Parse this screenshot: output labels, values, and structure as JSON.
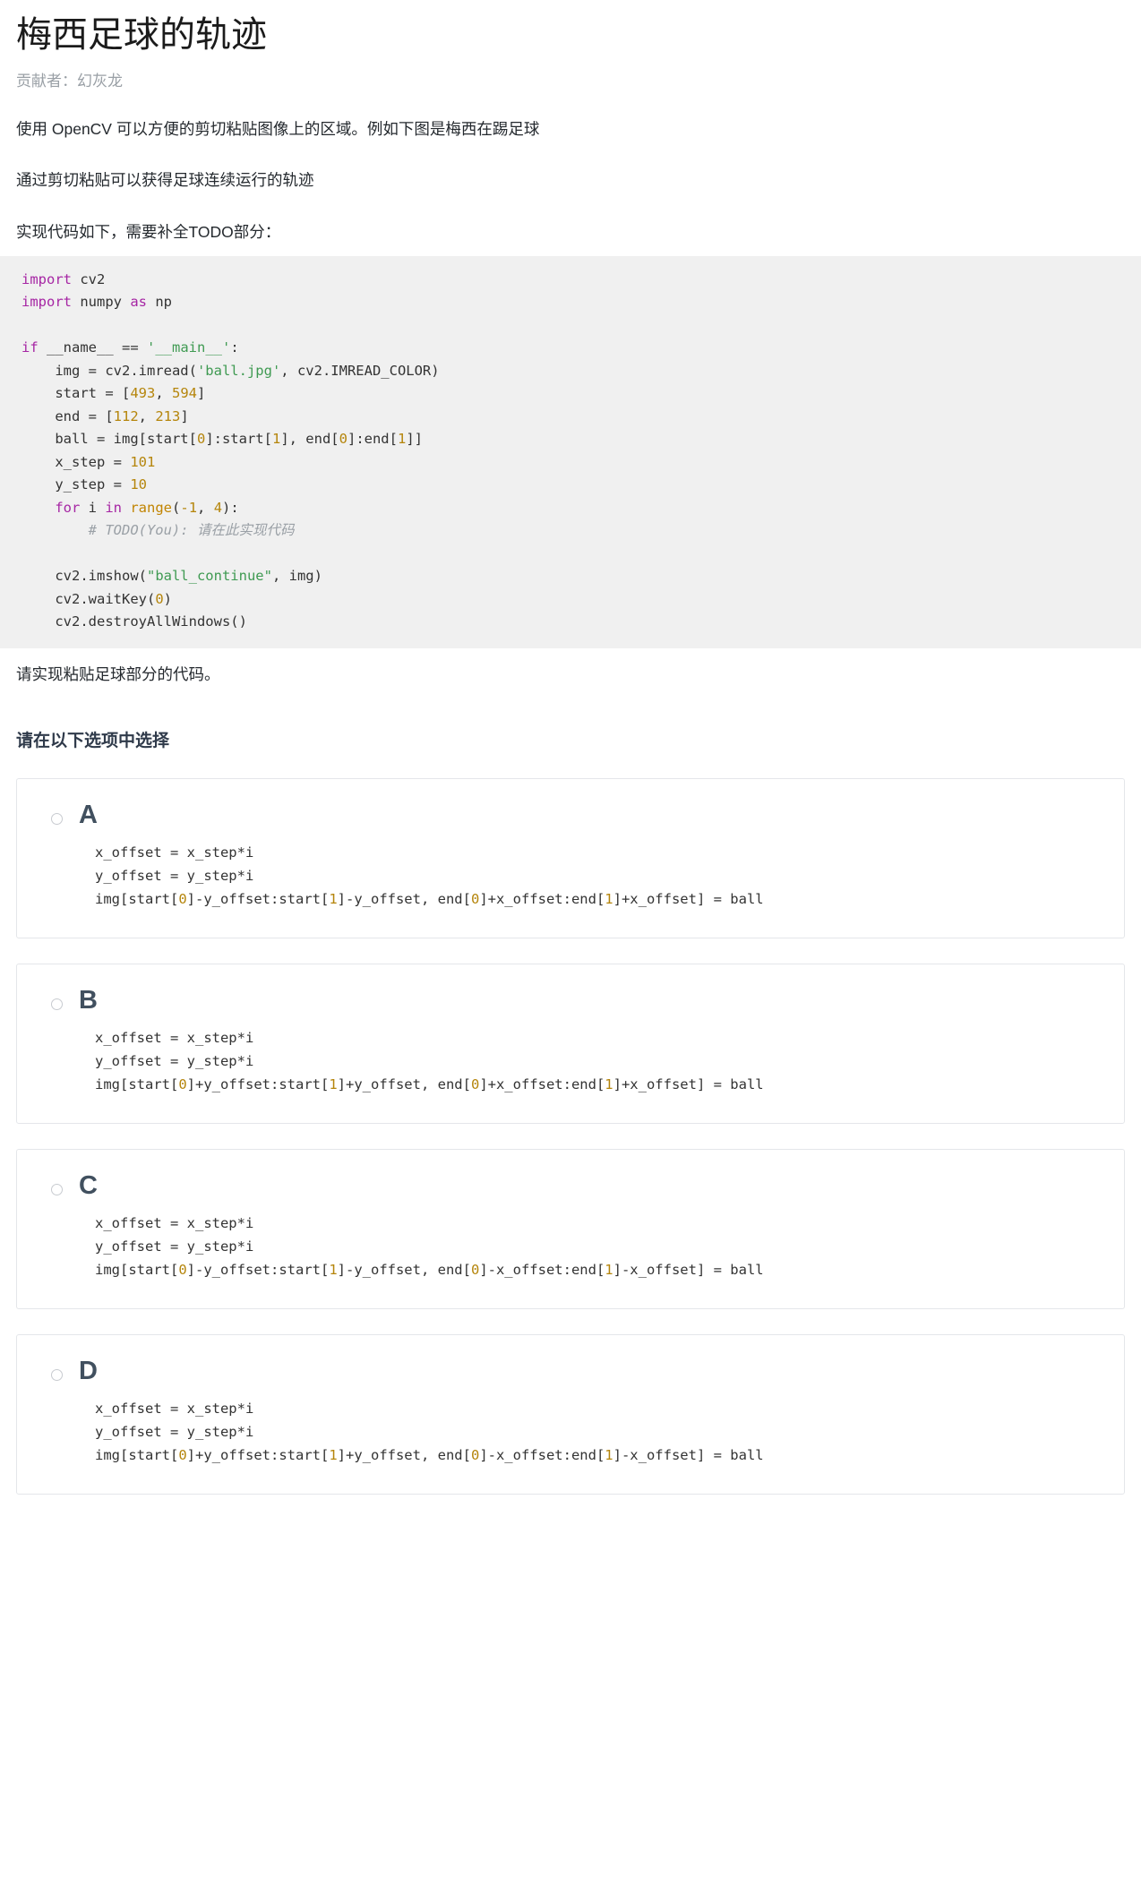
{
  "header": {
    "title": "梅西足球的轨迹",
    "contributor": "贡献者：幻灰龙"
  },
  "paragraphs": {
    "p1": "使用 OpenCV 可以方便的剪切粘贴图像上的区域。例如下图是梅西在踢足球",
    "p2": "通过剪切粘贴可以获得足球连续运行的轨迹",
    "p3": "实现代码如下，需要补全TODO部分：",
    "p4": "请实现粘贴足球部分的代码。"
  },
  "code": {
    "lines": [
      [
        {
          "t": "import",
          "c": "kw"
        },
        {
          "t": " cv2",
          "c": "pl"
        }
      ],
      [
        {
          "t": "import",
          "c": "kw"
        },
        {
          "t": " numpy ",
          "c": "pl"
        },
        {
          "t": "as",
          "c": "kw"
        },
        {
          "t": " np",
          "c": "pl"
        }
      ],
      [],
      [
        {
          "t": "if",
          "c": "kw"
        },
        {
          "t": " __name__ == ",
          "c": "pl"
        },
        {
          "t": "'__main__'",
          "c": "str"
        },
        {
          "t": ":",
          "c": "pl"
        }
      ],
      [
        {
          "t": "    img = cv2.imread(",
          "c": "pl"
        },
        {
          "t": "'ball.jpg'",
          "c": "str"
        },
        {
          "t": ", cv2.IMREAD_COLOR)",
          "c": "pl"
        }
      ],
      [
        {
          "t": "    start = [",
          "c": "pl"
        },
        {
          "t": "493",
          "c": "num"
        },
        {
          "t": ", ",
          "c": "pl"
        },
        {
          "t": "594",
          "c": "num"
        },
        {
          "t": "]",
          "c": "pl"
        }
      ],
      [
        {
          "t": "    end = [",
          "c": "pl"
        },
        {
          "t": "112",
          "c": "num"
        },
        {
          "t": ", ",
          "c": "pl"
        },
        {
          "t": "213",
          "c": "num"
        },
        {
          "t": "]",
          "c": "pl"
        }
      ],
      [
        {
          "t": "    ball = img[start[",
          "c": "pl"
        },
        {
          "t": "0",
          "c": "num"
        },
        {
          "t": "]:start[",
          "c": "pl"
        },
        {
          "t": "1",
          "c": "num"
        },
        {
          "t": "], end[",
          "c": "pl"
        },
        {
          "t": "0",
          "c": "num"
        },
        {
          "t": "]:end[",
          "c": "pl"
        },
        {
          "t": "1",
          "c": "num"
        },
        {
          "t": "]]",
          "c": "pl"
        }
      ],
      [
        {
          "t": "    x_step = ",
          "c": "pl"
        },
        {
          "t": "101",
          "c": "num"
        }
      ],
      [
        {
          "t": "    y_step = ",
          "c": "pl"
        },
        {
          "t": "10",
          "c": "num"
        }
      ],
      [
        {
          "t": "    ",
          "c": "pl"
        },
        {
          "t": "for",
          "c": "kw"
        },
        {
          "t": " i ",
          "c": "pl"
        },
        {
          "t": "in",
          "c": "kw"
        },
        {
          "t": " ",
          "c": "pl"
        },
        {
          "t": "range",
          "c": "bi"
        },
        {
          "t": "(",
          "c": "pl"
        },
        {
          "t": "-1",
          "c": "num"
        },
        {
          "t": ", ",
          "c": "pl"
        },
        {
          "t": "4",
          "c": "num"
        },
        {
          "t": "):",
          "c": "pl"
        }
      ],
      [
        {
          "t": "        # TODO(You): 请在此实现代码",
          "c": "cmt"
        }
      ],
      [],
      [
        {
          "t": "    cv2.imshow(",
          "c": "pl"
        },
        {
          "t": "\"ball_continue\"",
          "c": "str"
        },
        {
          "t": ", img)",
          "c": "pl"
        }
      ],
      [
        {
          "t": "    cv2.waitKey(",
          "c": "pl"
        },
        {
          "t": "0",
          "c": "num"
        },
        {
          "t": ")",
          "c": "pl"
        }
      ],
      [
        {
          "t": "    cv2.destroyAllWindows()",
          "c": "pl"
        }
      ]
    ]
  },
  "question": {
    "heading": "请在以下选项中选择"
  },
  "options": [
    {
      "letter": "A",
      "selected": false,
      "lines": [
        [
          {
            "t": "x_offset = x_step*i",
            "c": "pl"
          }
        ],
        [
          {
            "t": "y_offset = y_step*i",
            "c": "pl"
          }
        ],
        [
          {
            "t": "img[start[",
            "c": "pl"
          },
          {
            "t": "0",
            "c": "num"
          },
          {
            "t": "]-y_offset:start[",
            "c": "pl"
          },
          {
            "t": "1",
            "c": "num"
          },
          {
            "t": "]-y_offset, end[",
            "c": "pl"
          },
          {
            "t": "0",
            "c": "num"
          },
          {
            "t": "]+x_offset:end[",
            "c": "pl"
          },
          {
            "t": "1",
            "c": "num"
          },
          {
            "t": "]+x_offset] = ball",
            "c": "pl"
          }
        ]
      ]
    },
    {
      "letter": "B",
      "selected": false,
      "lines": [
        [
          {
            "t": "x_offset = x_step*i",
            "c": "pl"
          }
        ],
        [
          {
            "t": "y_offset = y_step*i",
            "c": "pl"
          }
        ],
        [
          {
            "t": "img[start[",
            "c": "pl"
          },
          {
            "t": "0",
            "c": "num"
          },
          {
            "t": "]+y_offset:start[",
            "c": "pl"
          },
          {
            "t": "1",
            "c": "num"
          },
          {
            "t": "]+y_offset, end[",
            "c": "pl"
          },
          {
            "t": "0",
            "c": "num"
          },
          {
            "t": "]+x_offset:end[",
            "c": "pl"
          },
          {
            "t": "1",
            "c": "num"
          },
          {
            "t": "]+x_offset] = ball",
            "c": "pl"
          }
        ]
      ]
    },
    {
      "letter": "C",
      "selected": false,
      "lines": [
        [
          {
            "t": "x_offset = x_step*i",
            "c": "pl"
          }
        ],
        [
          {
            "t": "y_offset = y_step*i",
            "c": "pl"
          }
        ],
        [
          {
            "t": "img[start[",
            "c": "pl"
          },
          {
            "t": "0",
            "c": "num"
          },
          {
            "t": "]-y_offset:start[",
            "c": "pl"
          },
          {
            "t": "1",
            "c": "num"
          },
          {
            "t": "]-y_offset, end[",
            "c": "pl"
          },
          {
            "t": "0",
            "c": "num"
          },
          {
            "t": "]-x_offset:end[",
            "c": "pl"
          },
          {
            "t": "1",
            "c": "num"
          },
          {
            "t": "]-x_offset] = ball",
            "c": "pl"
          }
        ]
      ]
    },
    {
      "letter": "D",
      "selected": false,
      "lines": [
        [
          {
            "t": "x_offset = x_step*i",
            "c": "pl"
          }
        ],
        [
          {
            "t": "y_offset = y_step*i",
            "c": "pl"
          }
        ],
        [
          {
            "t": "img[start[",
            "c": "pl"
          },
          {
            "t": "0",
            "c": "num"
          },
          {
            "t": "]+y_offset:start[",
            "c": "pl"
          },
          {
            "t": "1",
            "c": "num"
          },
          {
            "t": "]+y_offset, end[",
            "c": "pl"
          },
          {
            "t": "0",
            "c": "num"
          },
          {
            "t": "]-x_offset:end[",
            "c": "pl"
          },
          {
            "t": "1",
            "c": "num"
          },
          {
            "t": "]-x_offset] = ball",
            "c": "pl"
          }
        ]
      ]
    }
  ],
  "colors": {
    "keyword": "#a626a4",
    "string": "#3f9a52",
    "number": "#b5850b",
    "builtin": "#c18401",
    "comment": "#9aa0a6",
    "code_bg": "#f0f0f0",
    "heading": "#2f3a4a"
  }
}
